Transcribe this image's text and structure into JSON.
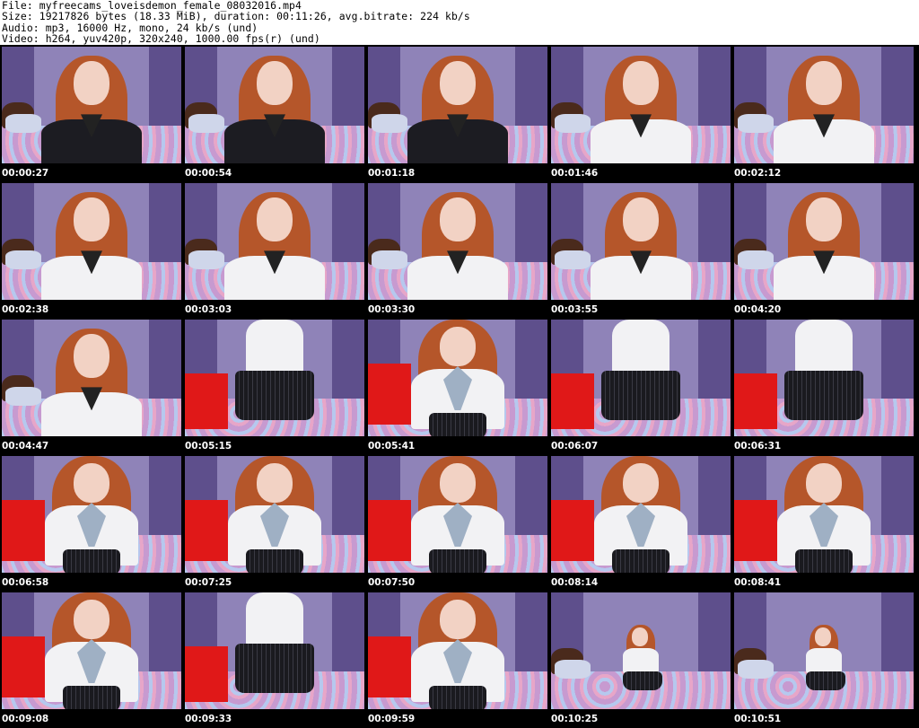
{
  "header": {
    "file_line": "File: myfreecams_loveisdemon_female_08032016.mp4",
    "size_line": "Size: 19217826 bytes (18.33 MiB), duration: 00:11:26, avg.bitrate: 224 kb/s",
    "audio_line": "Audio: mp3, 16000 Hz, mono, 24 kb/s (und)",
    "video_line": "Video: h264, yuv420p, 320x240, 1000.00 fps(r) (und)"
  },
  "thumbnails": [
    {
      "timestamp": "00:00:27",
      "scene": "close",
      "top": "black"
    },
    {
      "timestamp": "00:00:54",
      "scene": "close",
      "top": "black"
    },
    {
      "timestamp": "00:01:18",
      "scene": "close",
      "top": "black"
    },
    {
      "timestamp": "00:01:46",
      "scene": "close",
      "top": "white"
    },
    {
      "timestamp": "00:02:12",
      "scene": "close",
      "top": "white"
    },
    {
      "timestamp": "00:02:38",
      "scene": "close",
      "top": "white"
    },
    {
      "timestamp": "00:03:03",
      "scene": "close",
      "top": "white"
    },
    {
      "timestamp": "00:03:30",
      "scene": "close",
      "top": "white"
    },
    {
      "timestamp": "00:03:55",
      "scene": "close",
      "top": "white"
    },
    {
      "timestamp": "00:04:20",
      "scene": "close",
      "top": "white"
    },
    {
      "timestamp": "00:04:47",
      "scene": "close",
      "top": "white"
    },
    {
      "timestamp": "00:05:15",
      "scene": "standing",
      "top": "white"
    },
    {
      "timestamp": "00:05:41",
      "scene": "lean",
      "top": "white"
    },
    {
      "timestamp": "00:06:07",
      "scene": "standing",
      "top": "white"
    },
    {
      "timestamp": "00:06:31",
      "scene": "standing",
      "top": "white"
    },
    {
      "timestamp": "00:06:58",
      "scene": "lean",
      "top": "white"
    },
    {
      "timestamp": "00:07:25",
      "scene": "lean",
      "top": "white"
    },
    {
      "timestamp": "00:07:50",
      "scene": "lean",
      "top": "white"
    },
    {
      "timestamp": "00:08:14",
      "scene": "lean",
      "top": "white"
    },
    {
      "timestamp": "00:08:41",
      "scene": "lean",
      "top": "white"
    },
    {
      "timestamp": "00:09:08",
      "scene": "lean",
      "top": "white"
    },
    {
      "timestamp": "00:09:33",
      "scene": "standing",
      "top": "white"
    },
    {
      "timestamp": "00:09:59",
      "scene": "lean",
      "top": "white"
    },
    {
      "timestamp": "00:10:25",
      "scene": "far",
      "top": "white"
    },
    {
      "timestamp": "00:10:51",
      "scene": "far",
      "top": "white"
    }
  ],
  "colors": {
    "wall": "#8f83b8",
    "curtain": "#5e4f8c",
    "bed": "#c79ad0",
    "hair": "#b5562a",
    "skin": "#f2d2c4",
    "white_top": "#f2f2f4",
    "black_top": "#1c1c22",
    "red_box": "#e01818"
  }
}
